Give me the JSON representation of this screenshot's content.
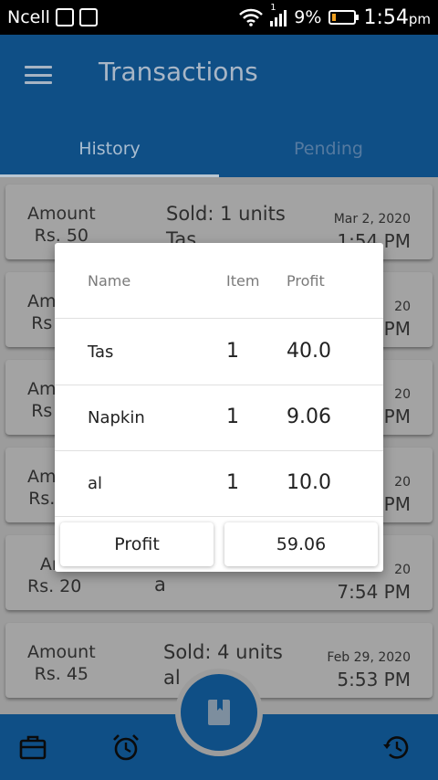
{
  "statusbar": {
    "carrier": "Ncell",
    "signal_badge": "1",
    "battery": "9%",
    "time": "1:54",
    "ampm": "pm"
  },
  "appbar": {
    "title": "Transactions",
    "menu_icon": "hamburger-menu-icon",
    "tabs": [
      {
        "label": "History",
        "active": true
      },
      {
        "label": "Pending",
        "active": false
      }
    ]
  },
  "list": {
    "cards": [
      {
        "amount_label": "Amount",
        "amount": "Rs. 50",
        "sold": "Sold: 1 units",
        "item": "Tas",
        "date": "Mar 2, 2020",
        "time": "1:54 PM"
      },
      {
        "amount_label": "Am",
        "amount": "Rs",
        "sold": "",
        "item": "",
        "date": "20",
        "time": "PM"
      },
      {
        "amount_label": "Am",
        "amount": "Rs",
        "sold": "",
        "item": "",
        "date": "20",
        "time": "PM"
      },
      {
        "amount_label": "Am",
        "amount": "Rs.",
        "sold": "",
        "item": "",
        "date": "20",
        "time": "PM"
      },
      {
        "amount_label": "Am",
        "amount": "Rs. 20",
        "sold": "",
        "item": "a",
        "date": "20",
        "time": "7:54 PM"
      },
      {
        "amount_label": "Amount",
        "amount": "Rs. 45",
        "sold": "Sold: 4 units",
        "item": "al",
        "date": "Feb 29, 2020",
        "time": "5:53 PM"
      }
    ]
  },
  "dialog": {
    "headers": {
      "name": "Name",
      "item": "Item",
      "profit": "Profit"
    },
    "rows": [
      {
        "name": "Tas",
        "item": "1",
        "profit": "40.0"
      },
      {
        "name": "Napkin",
        "item": "1",
        "profit": "9.06"
      },
      {
        "name": "al",
        "item": "1",
        "profit": "10.0"
      }
    ],
    "footer": {
      "label": "Profit",
      "value": "59.06"
    }
  },
  "bottomnav": {
    "items": [
      "briefcase-icon",
      "alarm-clock-icon",
      "book-icon",
      "history-icon"
    ]
  },
  "colors": {
    "primary": "#0f4f86",
    "scrim_background": "#9c9c9c",
    "battery_low": "#f0a020"
  }
}
